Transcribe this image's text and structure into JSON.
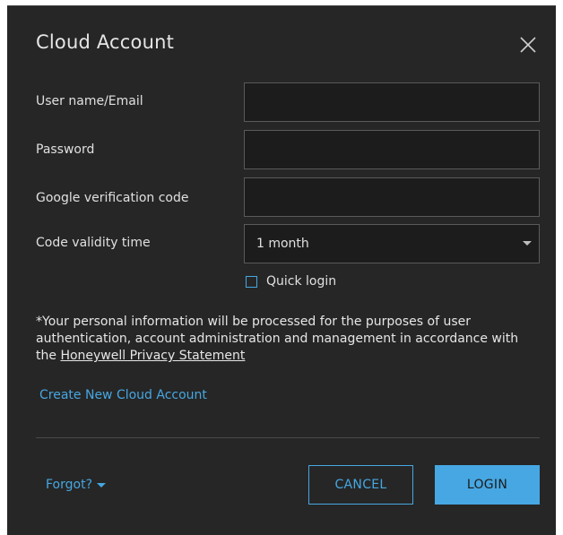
{
  "dialog": {
    "title": "Cloud Account",
    "close_icon": "close-icon"
  },
  "form": {
    "username_label": "User name/Email",
    "username_value": "",
    "password_label": "Password",
    "password_value": "",
    "google_code_label": "Google verification code",
    "google_code_value": "",
    "validity_label": "Code validity time",
    "validity_value": "1 month",
    "quick_login_label": "Quick login",
    "quick_login_checked": false
  },
  "notice": {
    "text": "*Your personal information will be processed for the purposes of user authentication, account administration and management in accordance with the ",
    "link": "Honeywell Privacy Statement"
  },
  "links": {
    "create_account": "Create New Cloud Account",
    "forgot": "Forgot?"
  },
  "buttons": {
    "cancel": "CANCEL",
    "login": "LOGIN"
  },
  "colors": {
    "background": "#262626",
    "accent": "#46a7e2",
    "field_bg": "#1c1c1c",
    "field_border": "#5a5a5a"
  }
}
